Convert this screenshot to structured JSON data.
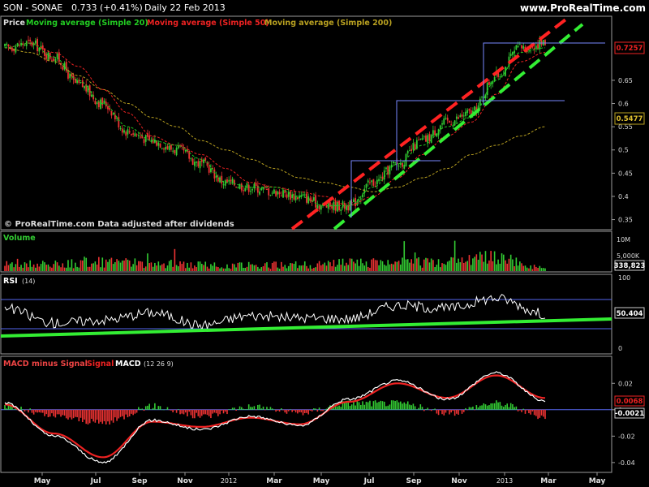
{
  "header": {
    "symbol": "SON - SONAE",
    "quote": "0.733 (+0.41%)",
    "period": "Daily  22 Feb 2013",
    "brand": "www.ProRealTime.com"
  },
  "price_panel": {
    "legend_price": "Price",
    "ma20_label": "Moving average (Simple 20)",
    "ma50_label": "Moving average (Simple 50)",
    "ma200_label": "Moving average (Simple 200)",
    "source_note": "© ProRealTime.com  Data adjusted after dividends",
    "current_price_box": "0.7257",
    "ma200_box": "0.5477",
    "yticks": [
      "0.65",
      "0.6",
      "0.55",
      "0.5",
      "0.45",
      "0.4",
      "0.35"
    ]
  },
  "volume_panel": {
    "title": "Volume",
    "yticks": [
      "10M",
      "5,000K"
    ],
    "value_box": "338,823"
  },
  "rsi_panel": {
    "title": "RSI",
    "params": "(14)",
    "yticks": [
      "100",
      "50",
      "0"
    ],
    "value_box": "50.404"
  },
  "macd_panel": {
    "title_hist": "MACD minus Signal",
    "title_signal": "Signal",
    "title_macd": "MACD",
    "params": "(12 26 9)",
    "yticks": [
      "0.02",
      "0",
      "-0.02",
      "-0.04"
    ],
    "macd_box": "0.0068",
    "hist_box": "-0.0021"
  },
  "x_axis": {
    "labels": [
      "May",
      "Jul",
      "Sep",
      "Nov",
      "2012",
      "Mar",
      "May",
      "Jul",
      "Sep",
      "Nov",
      "2013",
      "Mar",
      "May"
    ]
  },
  "colors": {
    "ma20": "#22cc22",
    "ma50": "#ee2222",
    "ma200": "#b8a020",
    "up_candle": "#33cc33",
    "down_candle": "#ee3333",
    "channel_upper": "#ff2222",
    "channel_lower": "#33ee33",
    "rsi_line": "#ffffff",
    "rsi_trend": "#33ee33",
    "macd": "#ffffff",
    "signal": "#ee2222",
    "hist_pos": "#33cc33",
    "hist_neg": "#ee3333",
    "box_lines": "#7788ff"
  },
  "chart_data": [
    {
      "type": "line",
      "title": "SON - SONAE",
      "y_scale": "price",
      "ylim": [
        0.33,
        0.76
      ],
      "x": [
        "2011-04",
        "2011-05",
        "2011-06",
        "2011-07",
        "2011-08",
        "2011-09",
        "2011-10",
        "2011-11",
        "2011-12",
        "2012-01",
        "2012-02",
        "2012-03",
        "2012-04",
        "2012-05",
        "2012-06",
        "2012-07",
        "2012-08",
        "2012-09",
        "2012-10",
        "2012-11",
        "2012-12",
        "2013-01",
        "2013-02"
      ],
      "series": [
        {
          "name": "Price",
          "values": [
            0.72,
            0.73,
            0.7,
            0.64,
            0.6,
            0.54,
            0.52,
            0.5,
            0.47,
            0.43,
            0.42,
            0.41,
            0.4,
            0.38,
            0.38,
            0.43,
            0.47,
            0.52,
            0.56,
            0.58,
            0.66,
            0.72,
            0.73
          ]
        },
        {
          "name": "Moving average (Simple 20)",
          "values": [
            0.72,
            0.73,
            0.7,
            0.65,
            0.6,
            0.55,
            0.52,
            0.51,
            0.48,
            0.43,
            0.42,
            0.42,
            0.4,
            0.38,
            0.38,
            0.42,
            0.47,
            0.51,
            0.55,
            0.57,
            0.65,
            0.71,
            0.72
          ]
        },
        {
          "name": "Moving average (Simple 50)",
          "values": [
            0.72,
            0.73,
            0.71,
            0.68,
            0.63,
            0.58,
            0.53,
            0.51,
            0.49,
            0.46,
            0.43,
            0.42,
            0.41,
            0.4,
            0.38,
            0.4,
            0.44,
            0.49,
            0.53,
            0.56,
            0.62,
            0.69,
            0.71
          ]
        },
        {
          "name": "Moving average (Simple 200)",
          "values": [
            0.72,
            0.71,
            0.69,
            0.66,
            0.63,
            0.6,
            0.57,
            0.55,
            0.52,
            0.5,
            0.48,
            0.46,
            0.44,
            0.43,
            0.42,
            0.41,
            0.42,
            0.44,
            0.46,
            0.49,
            0.51,
            0.53,
            0.55
          ]
        }
      ],
      "annotations": [
        "0.7257",
        "0.5477"
      ]
    },
    {
      "type": "bar",
      "title": "Volume",
      "x": [
        "2011-04",
        "2011-06",
        "2011-08",
        "2011-10",
        "2011-12",
        "2012-02",
        "2012-04",
        "2012-06",
        "2012-08",
        "2012-10",
        "2012-12",
        "2013-02"
      ],
      "values": [
        2400000,
        2000000,
        2600000,
        2200000,
        1900000,
        1700000,
        1800000,
        2300000,
        2600000,
        2500000,
        4000000,
        900000
      ],
      "last_value": 338823
    },
    {
      "type": "line",
      "title": "RSI (14)",
      "ylim": [
        0,
        100
      ],
      "x": [
        "2011-04",
        "2011-06",
        "2011-08",
        "2011-10",
        "2011-12",
        "2012-02",
        "2012-04",
        "2012-06",
        "2012-08",
        "2012-10",
        "2012-12",
        "2013-02"
      ],
      "values": [
        58,
        38,
        42,
        52,
        35,
        48,
        45,
        44,
        62,
        58,
        72,
        50.4
      ]
    },
    {
      "type": "line",
      "title": "MACD (12 26 9)",
      "ylim": [
        -0.045,
        0.03
      ],
      "x": [
        "2011-04",
        "2011-06",
        "2011-08",
        "2011-10",
        "2011-12",
        "2012-02",
        "2012-04",
        "2012-06",
        "2012-08",
        "2012-10",
        "2012-12",
        "2013-02"
      ],
      "series": [
        {
          "name": "MACD",
          "values": [
            0.005,
            -0.02,
            -0.04,
            -0.008,
            -0.015,
            -0.005,
            -0.012,
            0.008,
            0.022,
            0.008,
            0.028,
            0.0068
          ]
        },
        {
          "name": "Signal",
          "values": [
            0.004,
            -0.018,
            -0.036,
            -0.009,
            -0.013,
            -0.006,
            -0.011,
            0.006,
            0.02,
            0.009,
            0.026,
            0.0089
          ]
        },
        {
          "name": "MACD minus Signal",
          "values": [
            0.001,
            -0.002,
            -0.004,
            0.001,
            -0.002,
            0.001,
            -0.001,
            0.002,
            0.002,
            -0.001,
            0.002,
            -0.0021
          ]
        }
      ]
    }
  ]
}
